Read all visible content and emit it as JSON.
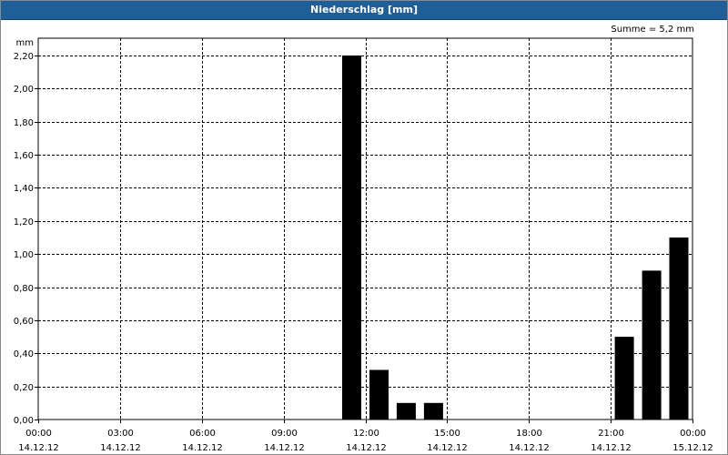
{
  "window": {
    "title": "Niederschlag [mm]"
  },
  "chart_data": {
    "type": "bar",
    "title": "Niederschlag [mm]",
    "ylabel": "mm",
    "summary": "Summe = 5,2 mm",
    "ylim": [
      0,
      2.3
    ],
    "yticks": [
      "0,00",
      "0,20",
      "0,40",
      "0,60",
      "0,80",
      "1,00",
      "1,20",
      "1,40",
      "1,60",
      "1,80",
      "2,00",
      "2,20"
    ],
    "xlim": [
      0,
      24
    ],
    "xticks": [
      {
        "time": "00:00",
        "date": "14.12.12"
      },
      {
        "time": "03:00",
        "date": "14.12.12"
      },
      {
        "time": "06:00",
        "date": "14.12.12"
      },
      {
        "time": "09:00",
        "date": "14.12.12"
      },
      {
        "time": "12:00",
        "date": "14.12.12"
      },
      {
        "time": "15:00",
        "date": "14.12.12"
      },
      {
        "time": "18:00",
        "date": "14.12.12"
      },
      {
        "time": "21:00",
        "date": "14.12.12"
      },
      {
        "time": "00:00",
        "date": "15.12.12"
      }
    ],
    "grid": true,
    "bars": [
      {
        "hour": 11,
        "value": 2.2
      },
      {
        "hour": 12,
        "value": 0.3
      },
      {
        "hour": 13,
        "value": 0.1
      },
      {
        "hour": 14,
        "value": 0.1
      },
      {
        "hour": 21,
        "value": 0.5
      },
      {
        "hour": 22,
        "value": 0.9
      },
      {
        "hour": 23,
        "value": 1.1
      }
    ],
    "bar_color": "#000000",
    "grid_color": "#000000"
  }
}
